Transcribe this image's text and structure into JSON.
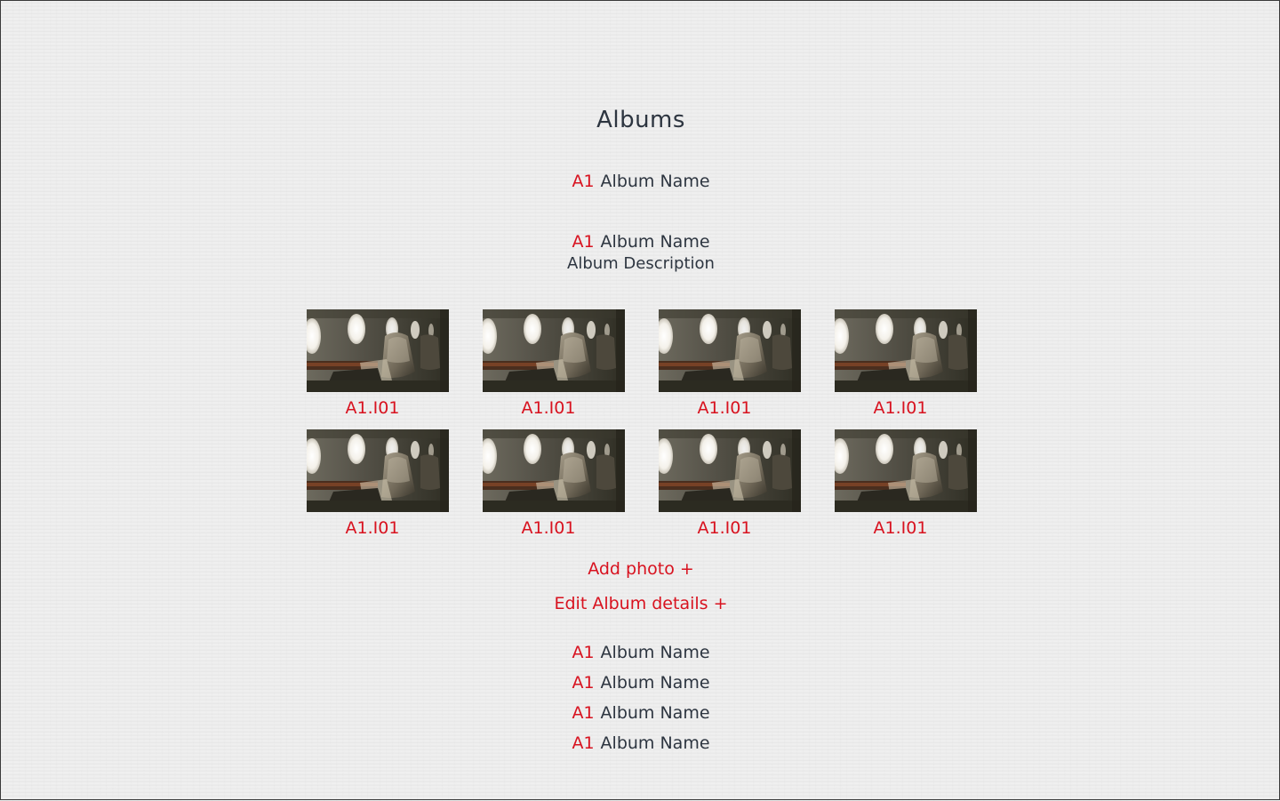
{
  "page": {
    "title": "Albums"
  },
  "colors": {
    "accent": "#d8121f",
    "text": "#2d3540",
    "background": "#efefef"
  },
  "albums_top": [
    {
      "code": "A1",
      "name": "Album Name"
    }
  ],
  "selected_album": {
    "code": "A1",
    "name": "Album Name",
    "description": "Album Description"
  },
  "photos": [
    {
      "caption": "A1.I01"
    },
    {
      "caption": "A1.I01"
    },
    {
      "caption": "A1.I01"
    },
    {
      "caption": "A1.I01"
    },
    {
      "caption": "A1.I01"
    },
    {
      "caption": "A1.I01"
    },
    {
      "caption": "A1.I01"
    },
    {
      "caption": "A1.I01"
    }
  ],
  "actions": {
    "add_photo": "Add photo +",
    "edit_album": "Edit Album details +"
  },
  "albums_bottom": [
    {
      "code": "A1",
      "name": "Album Name"
    },
    {
      "code": "A1",
      "name": "Album Name"
    },
    {
      "code": "A1",
      "name": "Album Name"
    },
    {
      "code": "A1",
      "name": "Album Name"
    }
  ]
}
